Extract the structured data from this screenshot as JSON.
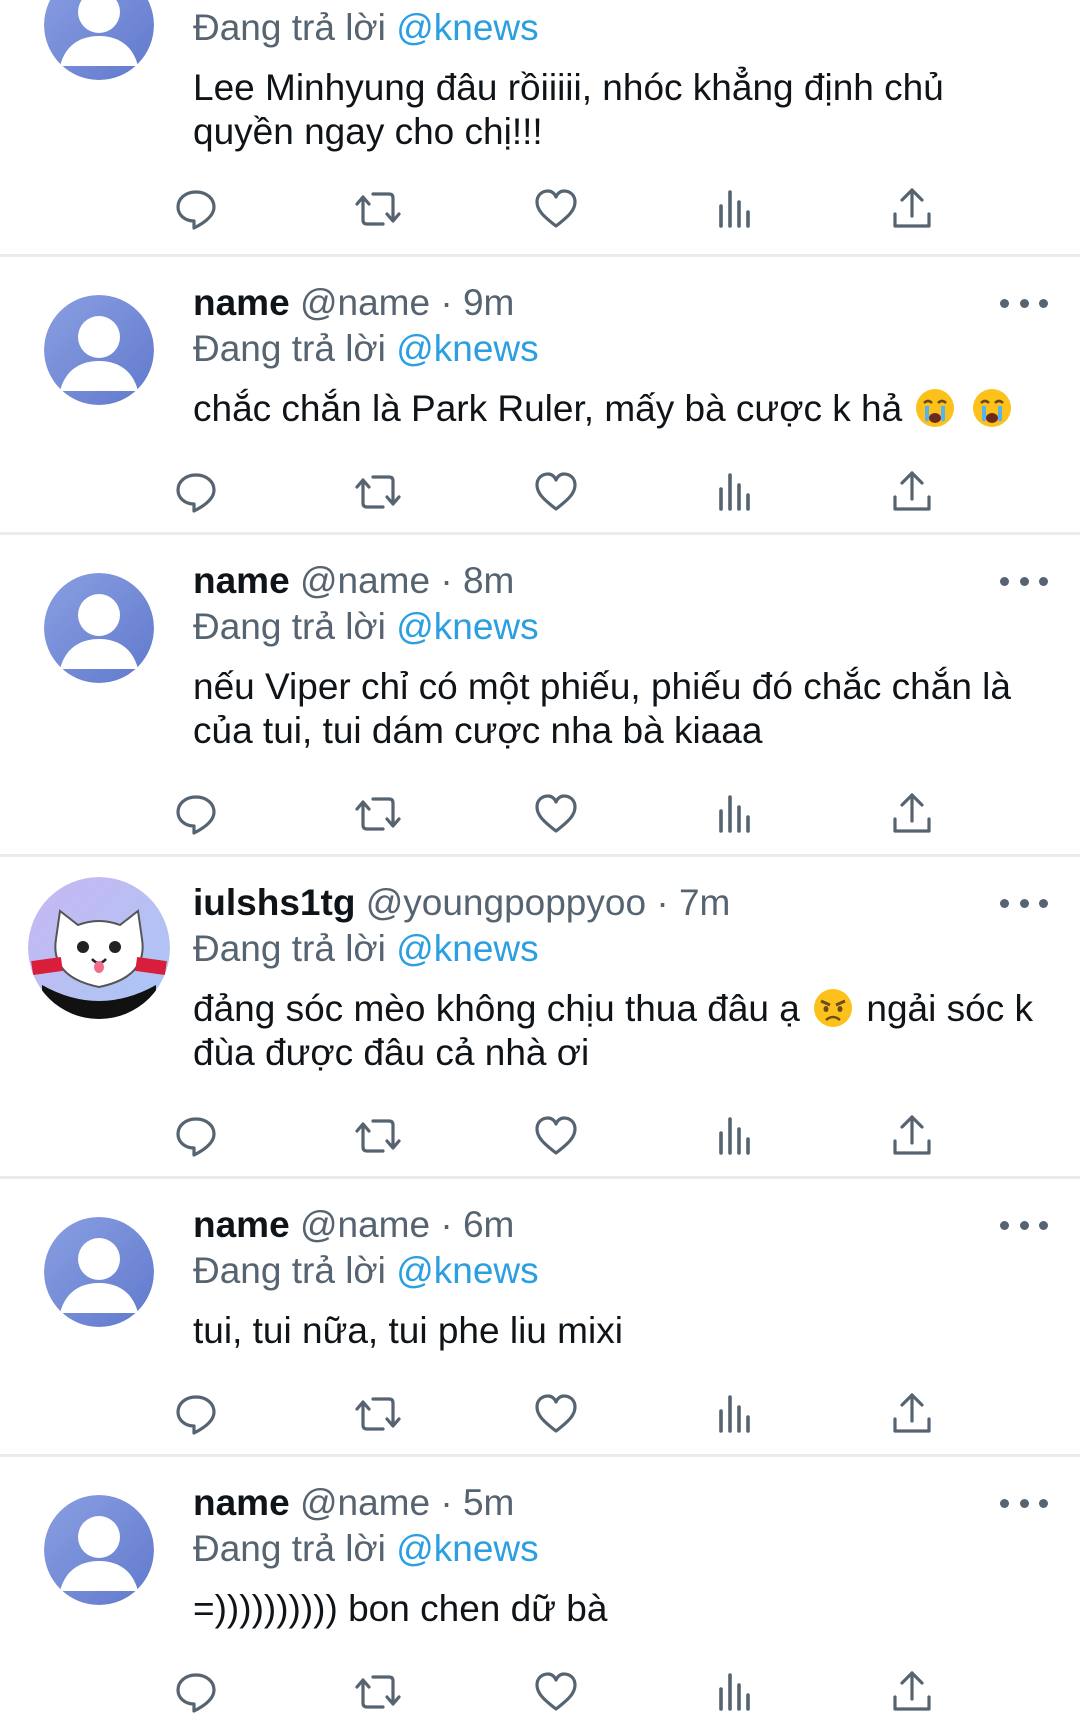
{
  "colors": {
    "text_primary": "#0f1419",
    "text_secondary": "#566370",
    "mention": "#2b9fe0",
    "divider": "#e8ecef",
    "default_avatar": "#6f86d6"
  },
  "icons": {
    "reply": "reply-bubble-icon",
    "retweet": "retweet-arrows-icon",
    "like": "heart-icon",
    "views": "bar-chart-icon",
    "share": "share-upload-icon",
    "more": "ellipsis-icon"
  },
  "reply_prefix": "Đang trả lời",
  "tweets": [
    {
      "name": "",
      "handle": "",
      "time": "",
      "reply_to": "@knews",
      "text": "Lee Minhyung đâu rồiiiii, nhóc khẳng định chủ quyền ngay cho chị!!!",
      "avatar": "default"
    },
    {
      "name": "name",
      "handle": "@name",
      "dot": "·",
      "time": "9m",
      "reply_to": "@knews",
      "text": "chắc chắn là Park Ruler, mấy bà cược k hả",
      "emoji": [
        "crying-face-emoji",
        "crying-face-emoji"
      ],
      "avatar": "default"
    },
    {
      "name": "name",
      "handle": "@name",
      "dot": "·",
      "time": "8m",
      "reply_to": "@knews",
      "text": "nếu Viper chỉ có một phiếu, phiếu đó chắc chắn là của tui, tui dám cược nha bà kiaaa",
      "avatar": "default"
    },
    {
      "name": "iulshs1tg",
      "handle": "@youngpoppyoo",
      "dot": "·",
      "time": "7m",
      "reply_to": "@knews",
      "text_before": "đảng sóc mèo không chịu thua đâu ạ",
      "emoji": [
        "angry-face-emoji"
      ],
      "text_after": "ngải sóc k đùa được đâu cả nhà ơi",
      "avatar": "cat-illustration"
    },
    {
      "name": "name",
      "handle": "@name",
      "dot": "·",
      "time": "6m",
      "reply_to": "@knews",
      "text": "tui, tui nữa, tui phe liu mixi",
      "avatar": "default"
    },
    {
      "name": "name",
      "handle": "@name",
      "dot": "·",
      "time": "5m",
      "reply_to": "@knews",
      "text": "=)))))))))) bon chen dữ bà",
      "avatar": "default"
    }
  ]
}
